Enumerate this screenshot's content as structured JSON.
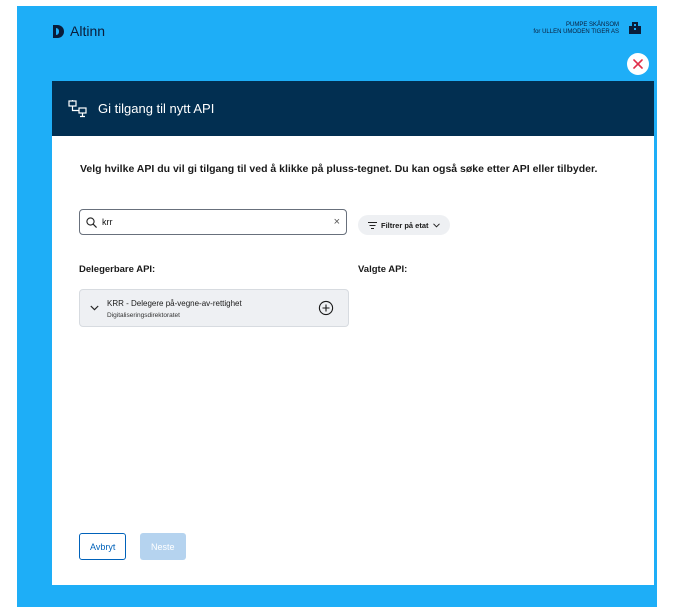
{
  "brand": {
    "name": "Altinn"
  },
  "account": {
    "user": "PUMPE SKÅNSOM",
    "org": "for ULLEN UMODEN TIGER AS"
  },
  "modal": {
    "title": "Gi tilgang til nytt API"
  },
  "intro": {
    "text": "Velg hvilke API du vil gi tilgang til ved å klikke på pluss-tegnet. Du kan også søke etter API eller tilbyder."
  },
  "search": {
    "value": "krr",
    "clear_glyph": "×"
  },
  "filter": {
    "label": "Filtrer på etat"
  },
  "columns": {
    "delegable": "Delegerbare API:",
    "selected": "Valgte API:"
  },
  "api_items": [
    {
      "name": "KRR - Delegere på-vegne-av-rettighet",
      "owner": "Digitaliseringsdirektoratet"
    }
  ],
  "buttons": {
    "cancel": "Avbryt",
    "next": "Neste"
  },
  "colors": {
    "frame": "#1eaef7",
    "header": "#022f51",
    "primary": "#0062ba",
    "close": "#e02e49"
  },
  "icons": [
    "altinn-logo-icon",
    "account-building-icon",
    "close-icon",
    "api-network-icon",
    "search-icon",
    "filter-icon",
    "chevron-down-icon",
    "add-circle-icon"
  ]
}
